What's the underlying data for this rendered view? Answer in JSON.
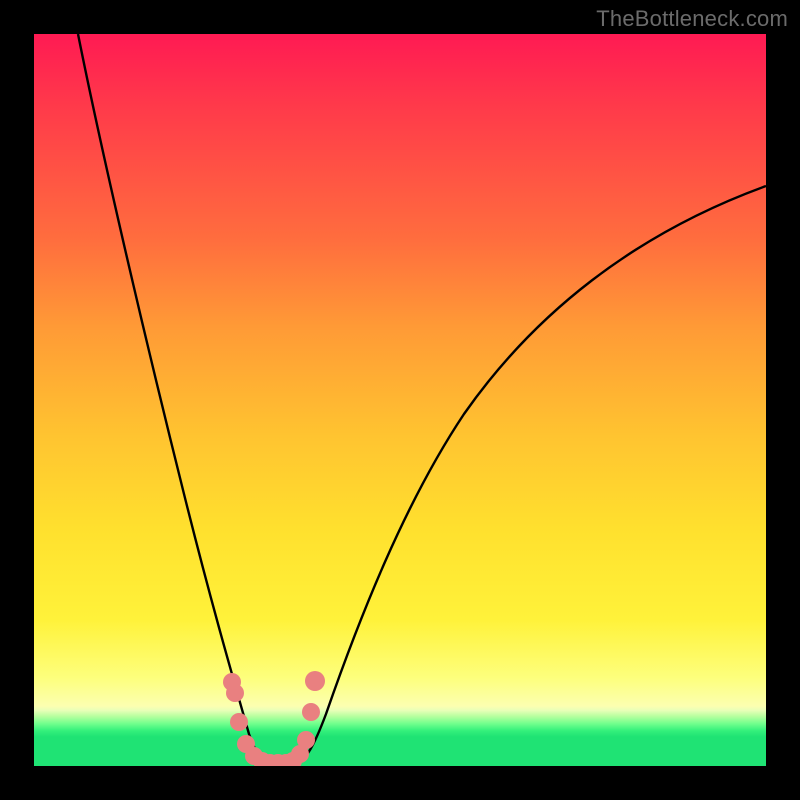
{
  "watermark": "TheBottleneck.com",
  "colors": {
    "frame": "#000000",
    "curve": "#000000",
    "marker": "#e98080",
    "gradient_top": "#ff1a53",
    "gradient_bottom": "#1fe374"
  },
  "chart_data": {
    "type": "line",
    "title": "",
    "xlabel": "",
    "ylabel": "",
    "xlim": [
      0,
      100
    ],
    "ylim": [
      0,
      100
    ],
    "grid": false,
    "series": [
      {
        "name": "left-branch",
        "x": [
          6,
          8,
          10,
          12,
          14,
          16,
          18,
          20,
          22,
          24,
          26,
          28,
          30
        ],
        "values": [
          100,
          86,
          73,
          62,
          52,
          43,
          35,
          28,
          20,
          13,
          7,
          3,
          0
        ]
      },
      {
        "name": "right-branch",
        "x": [
          36,
          38,
          40,
          44,
          48,
          52,
          56,
          60,
          66,
          72,
          78,
          86,
          94,
          100
        ],
        "values": [
          0,
          4,
          10,
          22,
          32,
          41,
          48,
          54,
          61,
          66,
          70,
          74,
          77,
          79
        ]
      },
      {
        "name": "floor",
        "x": [
          30,
          32,
          34,
          36
        ],
        "values": [
          0,
          0,
          0,
          0
        ]
      }
    ],
    "markers": {
      "name": "highlight-dots",
      "color": "#e98080",
      "points": [
        {
          "x": 26.5,
          "y": 13
        },
        {
          "x": 27.2,
          "y": 11
        },
        {
          "x": 28.0,
          "y": 5
        },
        {
          "x": 29.0,
          "y": 2
        },
        {
          "x": 30.0,
          "y": 1
        },
        {
          "x": 31.0,
          "y": 0.5
        },
        {
          "x": 32.0,
          "y": 0.5
        },
        {
          "x": 33.0,
          "y": 0.5
        },
        {
          "x": 34.0,
          "y": 0.5
        },
        {
          "x": 35.0,
          "y": 1
        },
        {
          "x": 36.0,
          "y": 2
        },
        {
          "x": 36.8,
          "y": 5
        },
        {
          "x": 37.5,
          "y": 10
        },
        {
          "x": 38.0,
          "y": 13
        }
      ]
    }
  }
}
